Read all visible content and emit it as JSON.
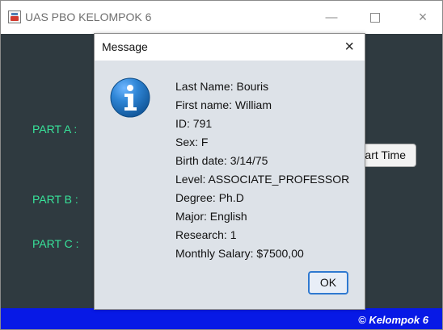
{
  "window": {
    "title": "UAS PBO KELOMPOK 6",
    "minimize_symbol": "—",
    "maximize_symbol": "",
    "close_symbol": "×"
  },
  "main": {
    "part_a_label": "PART A :",
    "part_b_label": "PART B :",
    "part_c_label": "PART C :",
    "part_time_button": "art Time",
    "footer_text": "© Kelompok 6"
  },
  "dialog": {
    "title": "Message",
    "close_symbol": "×",
    "icon": "info-icon",
    "lines": [
      "Last Name: Bouris",
      "First name: William",
      "ID: 791",
      "Sex: F",
      "Birth date: 3/14/75",
      "Level: ASSOCIATE_PROFESSOR",
      "Degree: Ph.D",
      "Major: English",
      "Research: 1",
      "Monthly Salary: $7500,00"
    ],
    "ok_label": "OK"
  },
  "colors": {
    "window_background": "#2f3a40",
    "label_green": "#38e39a",
    "footer_blue": "#0719e6",
    "dialog_background": "#dde2e8",
    "info_blue": "#1d73c5"
  }
}
